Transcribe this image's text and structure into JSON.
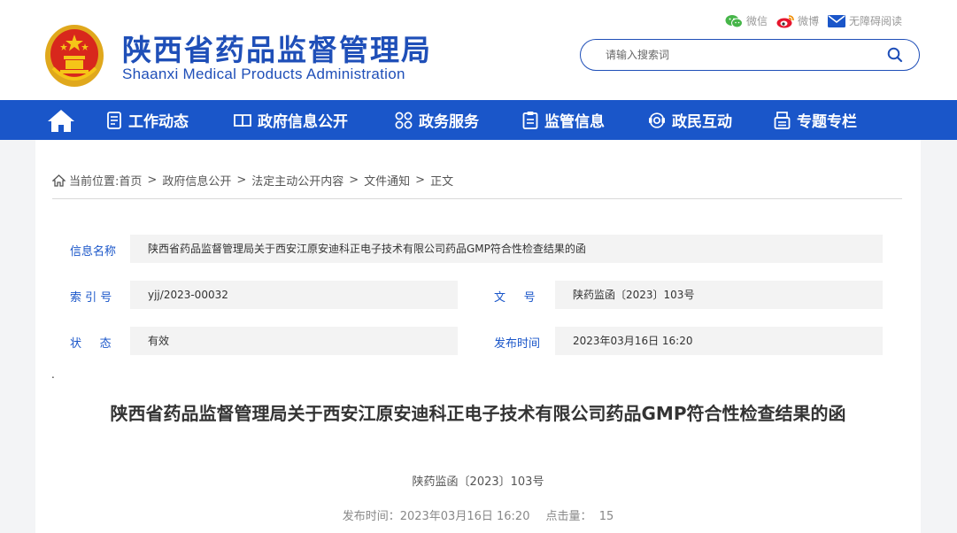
{
  "site": {
    "title_cn": "陕西省药品监督管理局",
    "title_en": "Shaanxi Medical Products Administration"
  },
  "top_links": {
    "wechat": "微信",
    "weibo": "微博",
    "accessible": "无障碍阅读"
  },
  "search": {
    "placeholder": "请输入搜索词"
  },
  "nav": {
    "items": [
      {
        "label": "工作动态"
      },
      {
        "label": "政府信息公开"
      },
      {
        "label": "政务服务"
      },
      {
        "label": "监管信息"
      },
      {
        "label": "政民互动"
      },
      {
        "label": "专题专栏"
      }
    ]
  },
  "breadcrumb": {
    "prefix": "当前位置:",
    "items": [
      "首页",
      "政府信息公开",
      "法定主动公开内容",
      "文件通知",
      "正文"
    ]
  },
  "info": {
    "name_label": "信息名称",
    "name_value": "陕西省药品监督管理局关于西安江原安迪科正电子技术有限公司药品GMP符合性检查结果的函",
    "index_label": "索 引 号",
    "index_value": "yjj/2023-00032",
    "docno_label": "文     号",
    "docno_value": "陕药监函〔2023〕103号",
    "status_label": "状     态",
    "status_value": "有效",
    "date_label": "发布时间",
    "date_value": "2023年03月16日 16:20"
  },
  "article": {
    "dot": ".",
    "title": "陕西省药品监督管理局关于西安江原安迪科正电子技术有限公司药品GMP符合性检查结果的函",
    "doc_no": "陕药监函〔2023〕103号",
    "publish_time": "发布时间：2023年03月16日 16:20",
    "clicks": "点击量：  15"
  },
  "colors": {
    "brand_blue": "#1a56c9",
    "emblem_red": "#d8271c",
    "emblem_gold": "#f5c518"
  }
}
